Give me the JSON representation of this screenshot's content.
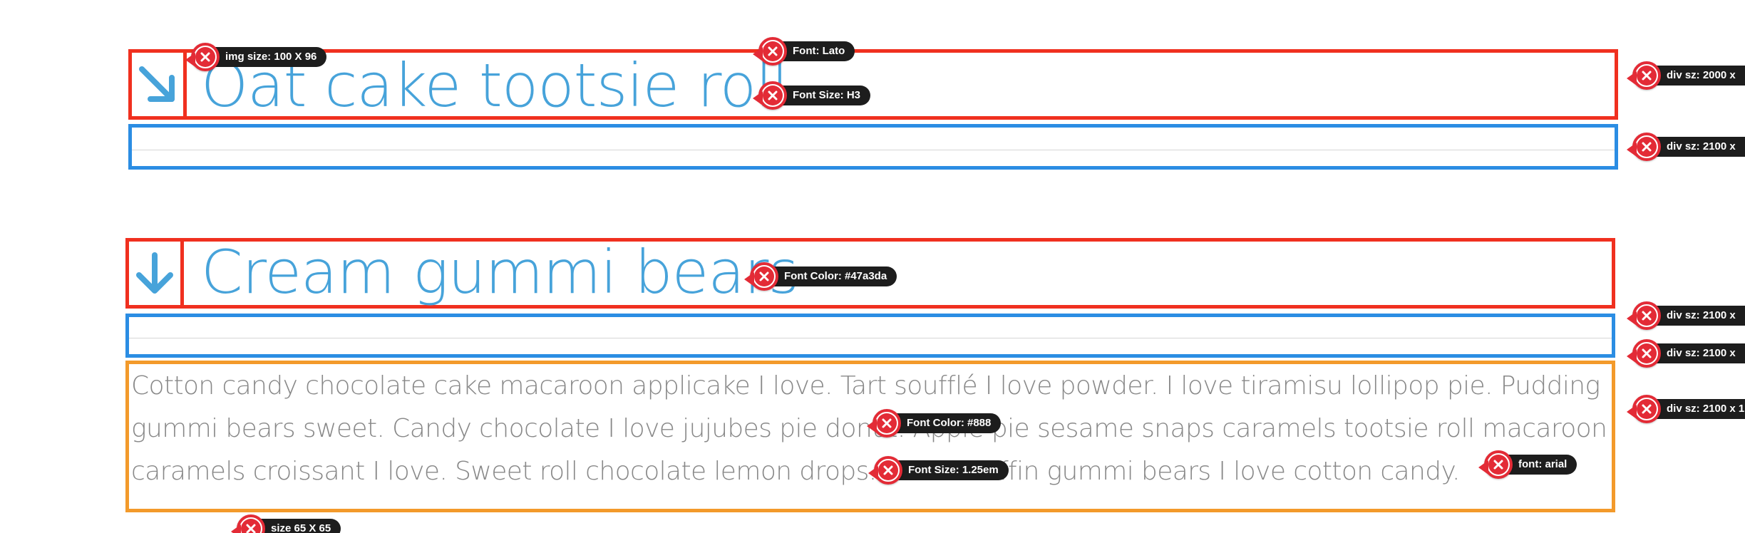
{
  "section1": {
    "heading": "Oat cake tootsie roll",
    "arrow_icon": "arrow-down-right-icon"
  },
  "section2": {
    "heading": "Cream gummi bears",
    "arrow_icon": "arrow-down-icon",
    "paragraph_lines": [
      "Cotton candy chocolate cake macaroon applicake I love. Tart soufflé I love powder. I love tiramisu lollipop pie. Pudding",
      "gummi bears sweet. Candy chocolate I love jujubes pie donut. Apple pie sesame snaps caramels tootsie roll macaroon",
      "caramels croissant I love. Sweet roll chocolate lemon drops. I love muffin gummi bears I love cotton candy."
    ]
  },
  "annotations": {
    "img_size": "img size: 100 X 96",
    "font_lato": "Font: Lato",
    "font_size_h3": "Font Size: H3",
    "div_sz_1": "div sz: 2000 x",
    "div_sz_2": "div sz: 2100 x",
    "font_color_blue": "Font Color: #47a3da",
    "div_sz_3": "div sz: 2100 x",
    "div_sz_4": "div sz: 2100 x",
    "font_color_grey": "Font Color: #888",
    "div_sz_5": "div sz: 2100 x 1",
    "font_size_125": "Font Size: 1.25em",
    "font_arial": "font: arial",
    "size_65": "size 65 X 65"
  },
  "colors": {
    "heading": "#47a3da",
    "paragraph": "#888888",
    "outline_red": "#f0301f",
    "outline_blue": "#2b8de3",
    "outline_orange": "#f39a2b",
    "marker_red": "#e32b36",
    "tag_bg": "#1d1d1d"
  }
}
